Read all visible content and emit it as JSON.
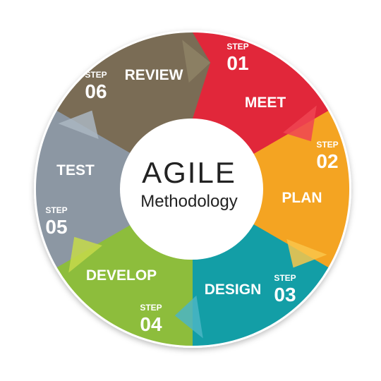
{
  "center": {
    "title": "AGILE",
    "subtitle": "Methodology"
  },
  "steps": [
    {
      "step_word": "STEP",
      "number": "01",
      "label": "MEET",
      "color": "#e1273a",
      "accent": "#ee4552"
    },
    {
      "step_word": "STEP",
      "number": "02",
      "label": "PLAN",
      "color": "#f4a422",
      "accent": "#f9c54a"
    },
    {
      "step_word": "STEP",
      "number": "03",
      "label": "DESIGN",
      "color": "#139ea6",
      "accent": "#4bb5c4"
    },
    {
      "step_word": "STEP",
      "number": "04",
      "label": "DEVELOP",
      "color": "#8dbd3c",
      "accent": "#c6d94a"
    },
    {
      "step_word": "STEP",
      "number": "05",
      "label": "TEST",
      "color": "#8c97a3",
      "accent": "#aab6c2"
    },
    {
      "step_word": "STEP",
      "number": "06",
      "label": "REVIEW",
      "color": "#7a6c55",
      "accent": "#8e8366"
    }
  ]
}
